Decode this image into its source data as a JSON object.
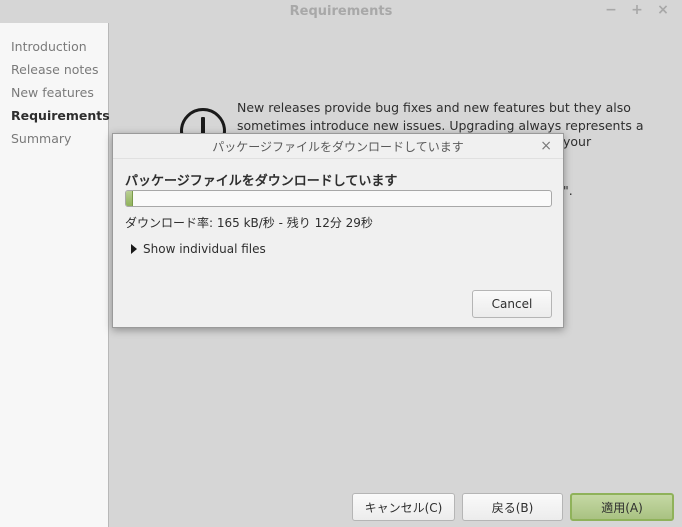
{
  "window": {
    "title": "Requirements",
    "controls": [
      "−",
      "+",
      "×"
    ]
  },
  "sidebar": {
    "items": [
      {
        "label": "Introduction",
        "active": false
      },
      {
        "label": "Release notes",
        "active": false
      },
      {
        "label": "New features",
        "active": false
      },
      {
        "label": "Requirements",
        "active": true
      },
      {
        "label": "Summary",
        "active": false
      }
    ]
  },
  "main": {
    "info_line1": "New releases provide bug fixes and new features but they also",
    "info_line2": "sometimes introduce new issues. Upgrading always represents a",
    "fragment_1": "your",
    "fragment_2": "\"."
  },
  "buttons": {
    "cancel": "キャンセル(C)",
    "back": "戻る(B)",
    "apply": "適用(A)"
  },
  "dialog": {
    "title": "パッケージファイルをダウンロードしています",
    "close": "×",
    "heading": "パッケージファイルをダウンロードしています",
    "progress": 0.017,
    "status": "ダウンロード率: 165 kB/秒 - 残り 12分 29秒",
    "expander_label": "Show individual files",
    "cancel_label": "Cancel"
  },
  "colors": {
    "accent": "#8fb25a",
    "background": "#d6d6d6",
    "sidebar": "#f7f7f7"
  }
}
